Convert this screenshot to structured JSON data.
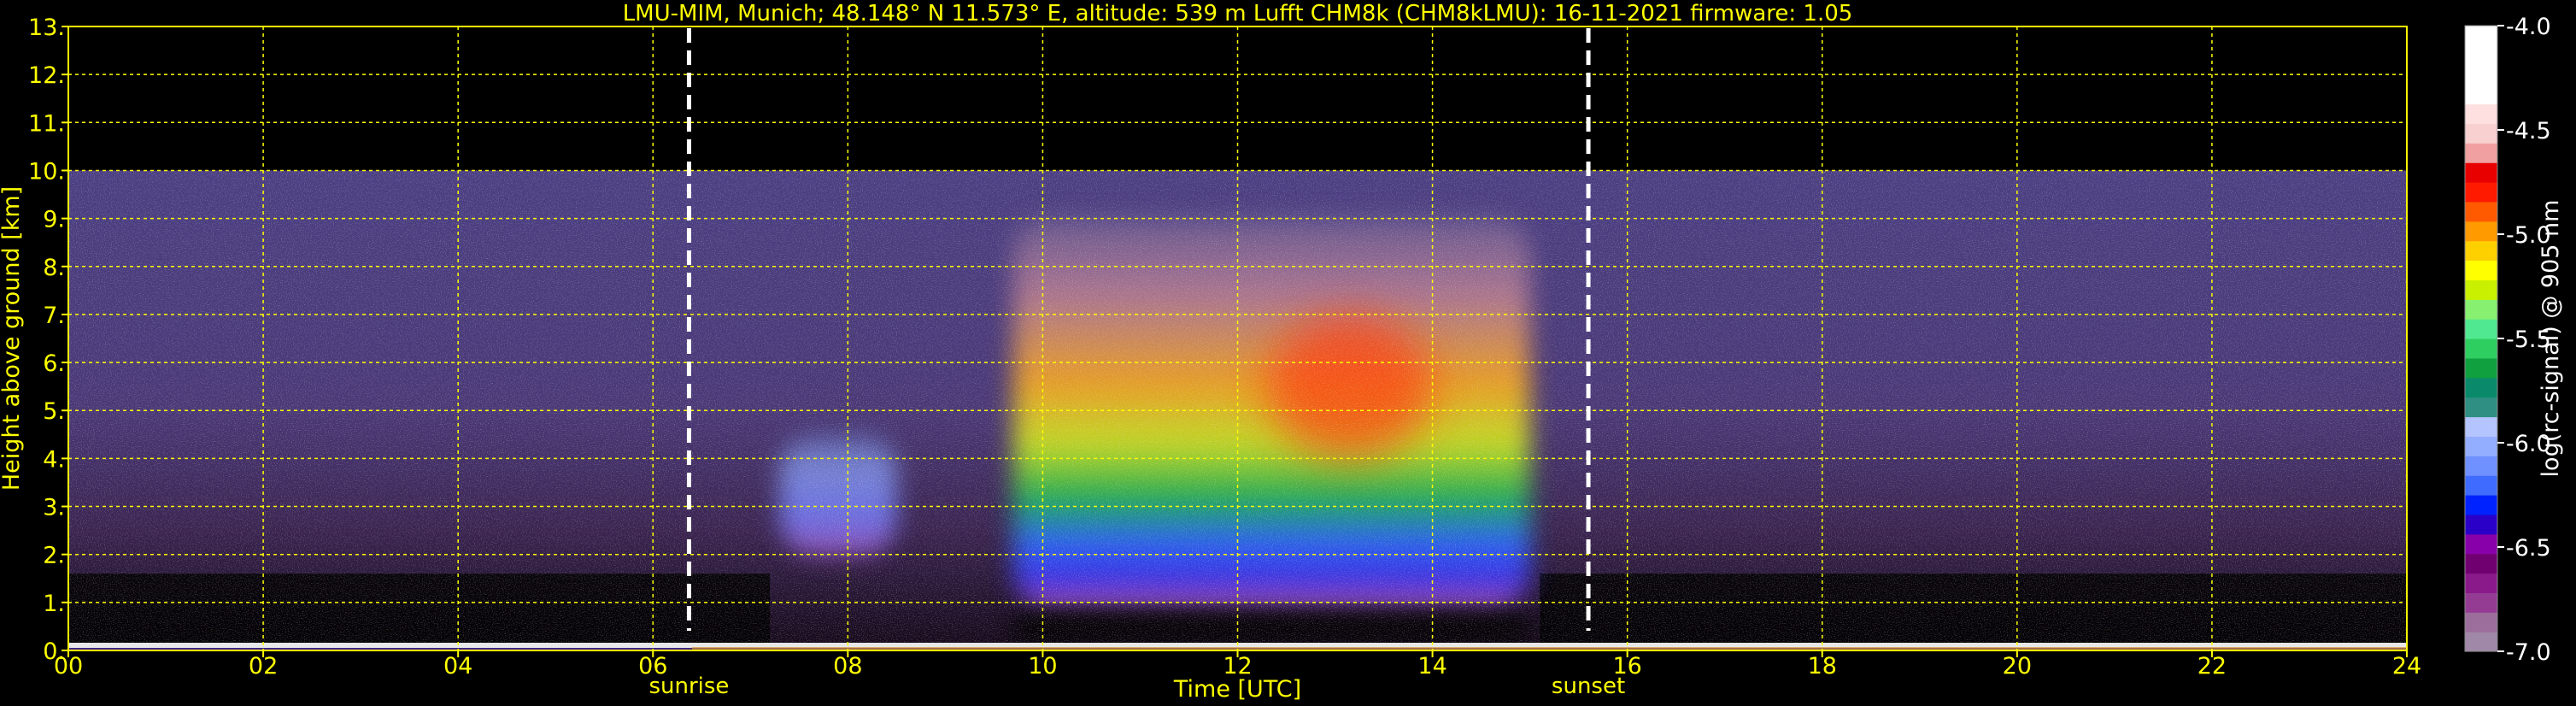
{
  "chart_data": {
    "type": "heatmap",
    "title": "LMU-MIM, Munich; 48.148° N 11.573° E, altitude: 539 m    Lufft CHM8k (CHM8kLMU): 16-11-2021    firmware: 1.05",
    "xlabel": "Time [UTC]",
    "ylabel": "Height above ground [km]",
    "xlim": [
      0,
      24
    ],
    "ylim": [
      0,
      13
    ],
    "x_ticks": [
      "00",
      "02",
      "04",
      "06",
      "08",
      "10",
      "12",
      "14",
      "16",
      "18",
      "20",
      "22",
      "24"
    ],
    "y_ticks": [
      "0.",
      "1.",
      "2.",
      "3.",
      "4.",
      "5.",
      "6.",
      "7.",
      "8.",
      "9.",
      "10.",
      "11.",
      "12.",
      "13."
    ],
    "grid": true,
    "max_range_km": 10,
    "markers": [
      {
        "label": "sunrise",
        "time": 6.37
      },
      {
        "label": "sunset",
        "time": 15.6
      }
    ],
    "aerosol_layer": [
      {
        "t_start": 7.3,
        "t_end": 8.5,
        "base_km": 2.0,
        "top_km": 4.5,
        "log_signal": -6.1
      },
      {
        "t_start": 9.7,
        "t_end": 15.0,
        "base_km": 0.9,
        "top_km": 9.0,
        "log_signal": -5.4
      },
      {
        "t_start": 12.3,
        "t_end": 14.0,
        "base_km": 4.0,
        "top_km": 7.0,
        "log_signal": -5.0
      }
    ],
    "colorbar": {
      "label": "log(rc-signal) @ 905 nm",
      "range": [
        -7.0,
        -4.0
      ],
      "ticks": [
        "-4.0",
        "-4.5",
        "-5.0",
        "-5.5",
        "-6.0",
        "-6.5",
        "-7.0"
      ],
      "colors": [
        "#a088a8",
        "#9c6e9c",
        "#943c94",
        "#8a1a8a",
        "#700070",
        "#8800aa",
        "#2a00c8",
        "#0022ff",
        "#3f6bff",
        "#6f90ff",
        "#94aeff",
        "#b4c4ff",
        "#2e8f82",
        "#0a8a6a",
        "#10a040",
        "#2ece60",
        "#50e890",
        "#88f070",
        "#c8f000",
        "#ffff00",
        "#ffd000",
        "#ff9a00",
        "#ff5a00",
        "#ff1a00",
        "#e80000",
        "#f0a0a0",
        "#f8d0d0",
        "#ffe0e0",
        "#ffffff",
        "#ffffff",
        "#ffffff",
        "#ffffff"
      ]
    }
  }
}
